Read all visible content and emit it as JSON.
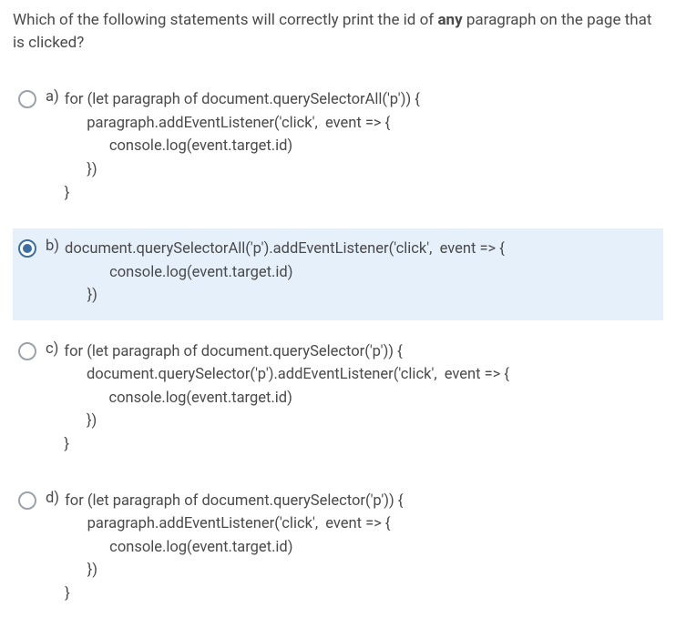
{
  "question_prefix": "Which of the following statements will correctly print the id of ",
  "question_bold": "any",
  "question_suffix": " paragraph on the page that is clicked?",
  "options": [
    {
      "letter": "a)",
      "selected": false,
      "code": "for (let paragraph of document.querySelectorAll('p')) {\n      paragraph.addEventListener('click',  event => {\n            console.log(event.target.id)\n      })\n}"
    },
    {
      "letter": "b)",
      "selected": true,
      "code": "document.querySelectorAll('p').addEventListener('click',  event => {\n            console.log(event.target.id)\n      })"
    },
    {
      "letter": "c)",
      "selected": false,
      "code": "for (let paragraph of document.querySelector('p')) {\n      document.querySelector('p').addEventListener('click',  event => {\n            console.log(event.target.id)\n      })\n}"
    },
    {
      "letter": "d)",
      "selected": false,
      "code": "for (let paragraph of document.querySelector('p')) {\n      paragraph.addEventListener('click',  event => {\n            console.log(event.target.id)\n      })\n}"
    }
  ]
}
